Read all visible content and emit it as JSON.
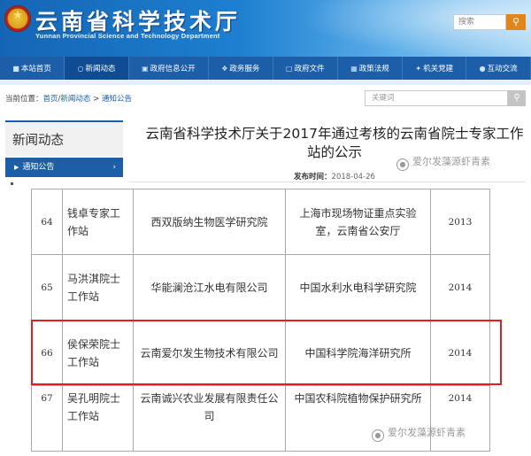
{
  "header": {
    "title": "云南省科学技术厅",
    "subtitle": "Yunnan Provincial Science and Technology Department",
    "search_placeholder": "搜索",
    "search_icon": "search-icon"
  },
  "nav": [
    {
      "label": "本站首页",
      "icon": "home-icon"
    },
    {
      "label": "新闻动态",
      "icon": "circle-icon"
    },
    {
      "label": "政府信息公开",
      "icon": "info-icon"
    },
    {
      "label": "政务服务",
      "icon": "service-icon"
    },
    {
      "label": "政府文件",
      "icon": "document-icon"
    },
    {
      "label": "政策法规",
      "icon": "policy-icon"
    },
    {
      "label": "机关党建",
      "icon": "party-icon"
    },
    {
      "label": "互动交流",
      "icon": "chat-icon"
    }
  ],
  "breadcrumb": {
    "prefix": "当前位置：",
    "home": "首页",
    "sep1": "/",
    "news": "新闻动态",
    "sep2": " > ",
    "current": "通知公告"
  },
  "crumb_search": {
    "placeholder": "关键词"
  },
  "sidebar": {
    "heading": "新闻动态",
    "item": "通知公告"
  },
  "article": {
    "title": "云南省科学技术厅关于2017年通过考核的云南省院士专家工作站的公示",
    "date_label": "发布时间：",
    "date": "2018-04-26"
  },
  "table": {
    "rows": [
      {
        "no": "64",
        "station": "钱卓专家工作站",
        "host": "西双版纳生物医学研究院",
        "partner": "上海市现场物证重点实验室，云南省公安厅",
        "year": "2013"
      },
      {
        "no": "65",
        "station": "马洪淇院士工作站",
        "host": "华能澜沧江水电有限公司",
        "partner": "中国水利水电科学研究院",
        "year": "2014"
      },
      {
        "no": "66",
        "station": "侯保荣院士工作站",
        "host": "云南爱尔发生物技术有限公司",
        "partner": "中国科学院海洋研究所",
        "year": "2014"
      },
      {
        "no": "67",
        "station": "吴孔明院士工作站",
        "host": "云南诚兴农业发展有限责任公司",
        "partner": "中国农科院植物保护研究所",
        "year": "2014"
      }
    ]
  },
  "watermark": {
    "text": "爱尔发藻源虾青素"
  },
  "colors": {
    "nav_blue": "#1d5ea8",
    "highlight_red": "#e0201d"
  }
}
